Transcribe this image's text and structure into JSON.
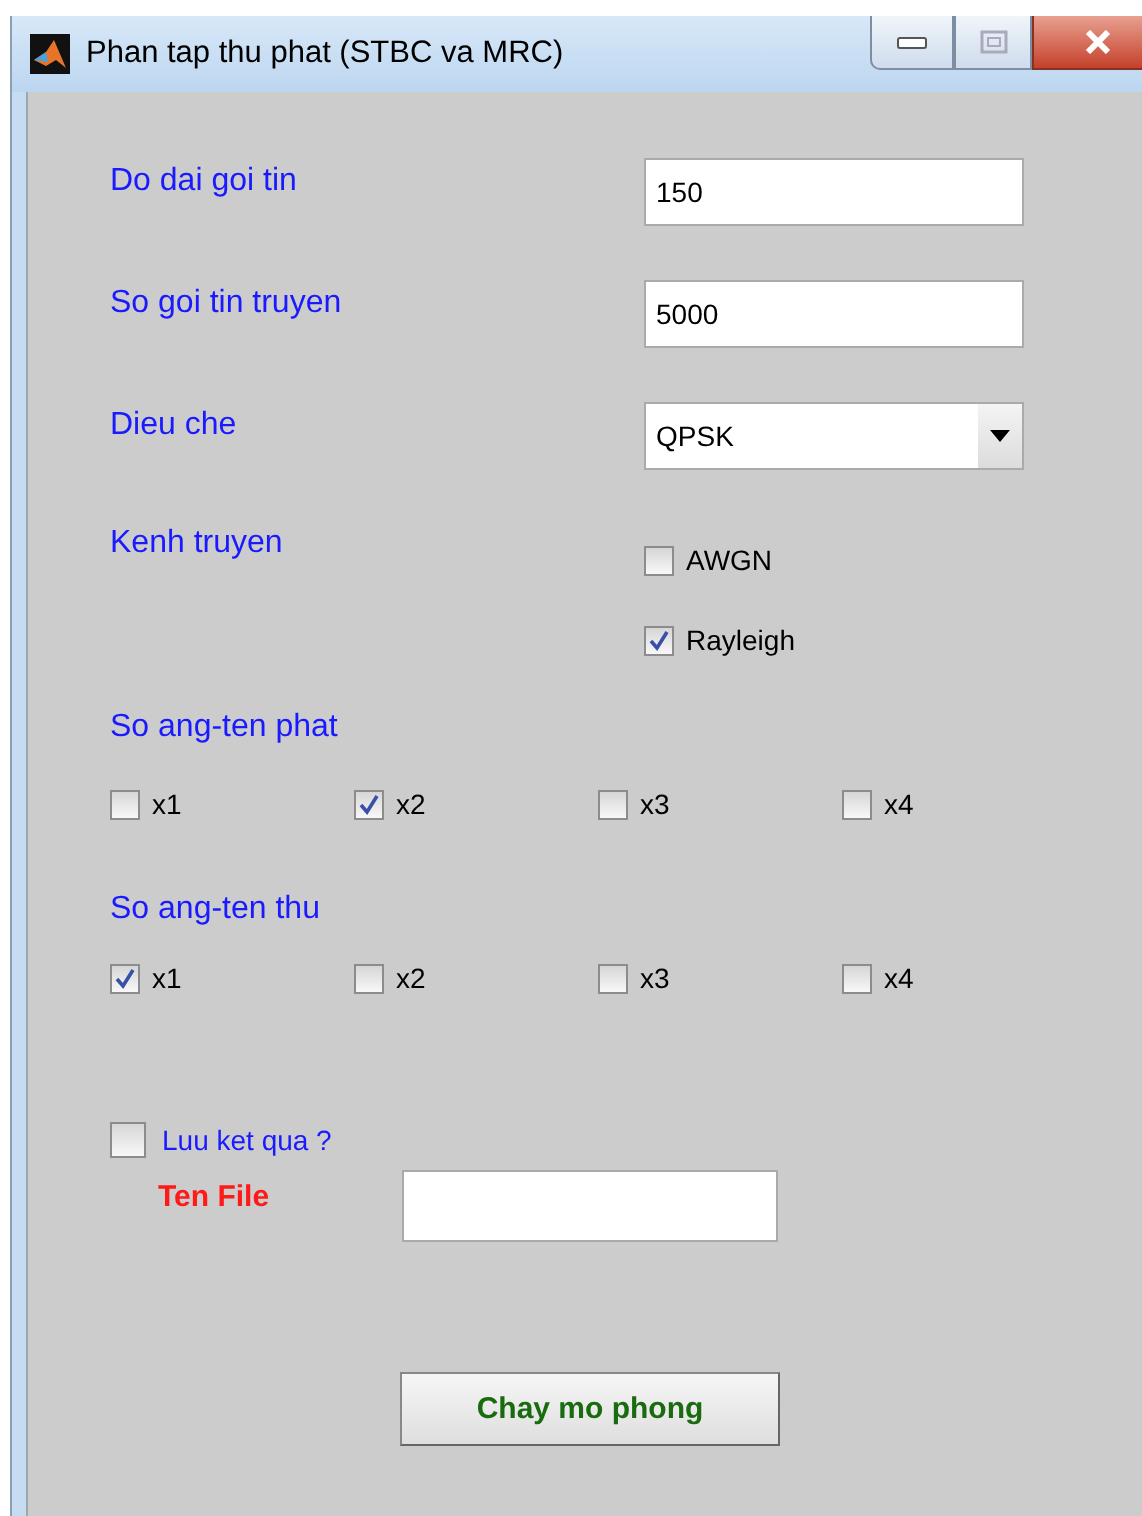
{
  "window": {
    "title": "Phan tap thu phat (STBC va MRC)"
  },
  "fields": [
    {
      "label": "Do dai goi tin",
      "value": "150"
    },
    {
      "label": "So goi tin truyen",
      "value": "5000"
    }
  ],
  "modulation": {
    "label": "Dieu che",
    "value": "QPSK"
  },
  "channel": {
    "label": "Kenh truyen",
    "options": [
      {
        "label": "AWGN",
        "checked": false
      },
      {
        "label": "Rayleigh",
        "checked": true
      }
    ]
  },
  "tx_antennas": {
    "label": "So ang-ten phat",
    "options": [
      {
        "label": "x1",
        "checked": false
      },
      {
        "label": "x2",
        "checked": true
      },
      {
        "label": "x3",
        "checked": false
      },
      {
        "label": "x4",
        "checked": false
      }
    ]
  },
  "rx_antennas": {
    "label": "So ang-ten thu",
    "options": [
      {
        "label": "x1",
        "checked": true
      },
      {
        "label": "x2",
        "checked": false
      },
      {
        "label": "x3",
        "checked": false
      },
      {
        "label": "x4",
        "checked": false
      }
    ]
  },
  "save": {
    "label": "Luu ket qua ?",
    "checked": false
  },
  "file_name": {
    "label": "Ten File"
  },
  "run_button": "Chay mo phong"
}
